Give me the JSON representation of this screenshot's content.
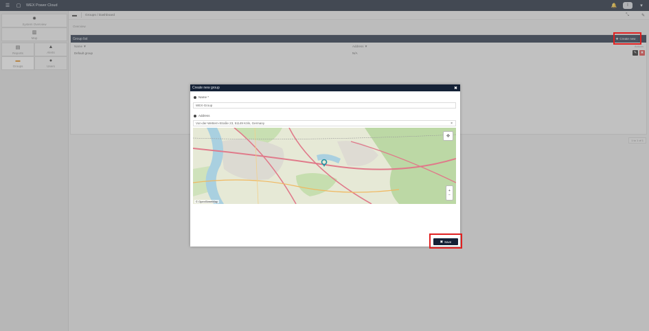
{
  "topbar": {
    "app_title": "WEX Power Cloud",
    "menu_icon": "hamburger-icon",
    "app_icon": "device-icon",
    "bell_icon": "bell-icon",
    "avatar_label": "I",
    "dropdown_glyph": "▾"
  },
  "sidebar": {
    "items": [
      {
        "label": "System Overview",
        "icon": "gear-sun-icon",
        "glyph": "✹"
      },
      {
        "label": "Map",
        "icon": "map-icon",
        "glyph": "▥"
      },
      {
        "label": "Reports",
        "icon": "report-icon",
        "glyph": "▤"
      },
      {
        "label": "Alerts",
        "icon": "alert-bell-icon",
        "glyph": "▲"
      },
      {
        "label": "Groups",
        "icon": "briefcase-icon",
        "glyph": "▬"
      },
      {
        "label": "Users",
        "icon": "users-icon",
        "glyph": "●"
      }
    ]
  },
  "breadcrumb": {
    "icon": "briefcase-icon",
    "text": "Groups / Dashboard",
    "expand_glyph": "⤡",
    "pin_glyph": "✎"
  },
  "overview_label": "Overview",
  "groups_panel": {
    "title": "Group list",
    "create_label": "Create new",
    "columns": [
      "Name ▼",
      "Address ▼"
    ],
    "actions_header": "Actions",
    "rows": [
      {
        "name": "Default group",
        "address": "N/A"
      }
    ],
    "pager": "1 to 1 of 1"
  },
  "modal": {
    "title": "Create new group",
    "close_glyph": "✖",
    "name_label": "Name *",
    "name_value": "WEX-Group",
    "address_label": "Address",
    "address_value": "Von-der-Wettern-Straße 23, 51149 Köln, Germany",
    "clear_glyph": "×",
    "map_attribution": "© OpenStreetMap",
    "zoom_in": "+",
    "zoom_out": "−",
    "layers_glyph": "❖",
    "save_label": "Save"
  },
  "colors": {
    "topbar": "#0f1b2d",
    "header": "#16243a",
    "highlight": "#e02020",
    "delete": "#e33b3b"
  }
}
